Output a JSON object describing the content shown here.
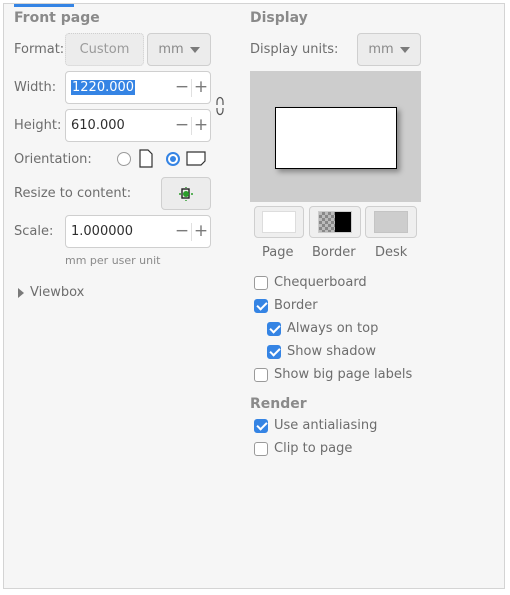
{
  "front_page": {
    "header": "Front page",
    "format_label": "Format:",
    "format_value": "Custom",
    "format_unit": "mm",
    "width_label": "Width:",
    "width_value": "1220.000",
    "height_label": "Height:",
    "height_value": "610.000",
    "orientation_label": "Orientation:",
    "orientation_selected": "landscape",
    "resize_label": "Resize to content:",
    "scale_label": "Scale:",
    "scale_value": "1.000000",
    "scale_hint": "mm per user unit",
    "viewbox_label": "Viewbox"
  },
  "display": {
    "header": "Display",
    "units_label": "Display units:",
    "units_value": "mm",
    "swatch_labels": [
      "Page",
      "Border",
      "Desk"
    ],
    "checkboxes": [
      {
        "label": "Chequerboard",
        "checked": false
      },
      {
        "label": "Border",
        "checked": true
      },
      {
        "label": "Always on top",
        "checked": true
      },
      {
        "label": "Show shadow",
        "checked": true
      },
      {
        "label": "Show big page labels",
        "checked": false
      }
    ]
  },
  "render": {
    "header": "Render",
    "checkboxes": [
      {
        "label": "Use antialiasing",
        "checked": true
      },
      {
        "label": "Clip to page",
        "checked": false
      }
    ]
  },
  "colors": {
    "accent": "#3584e4",
    "desk": "#cdcdcd",
    "page": "#ffffff",
    "border": "#000000"
  }
}
